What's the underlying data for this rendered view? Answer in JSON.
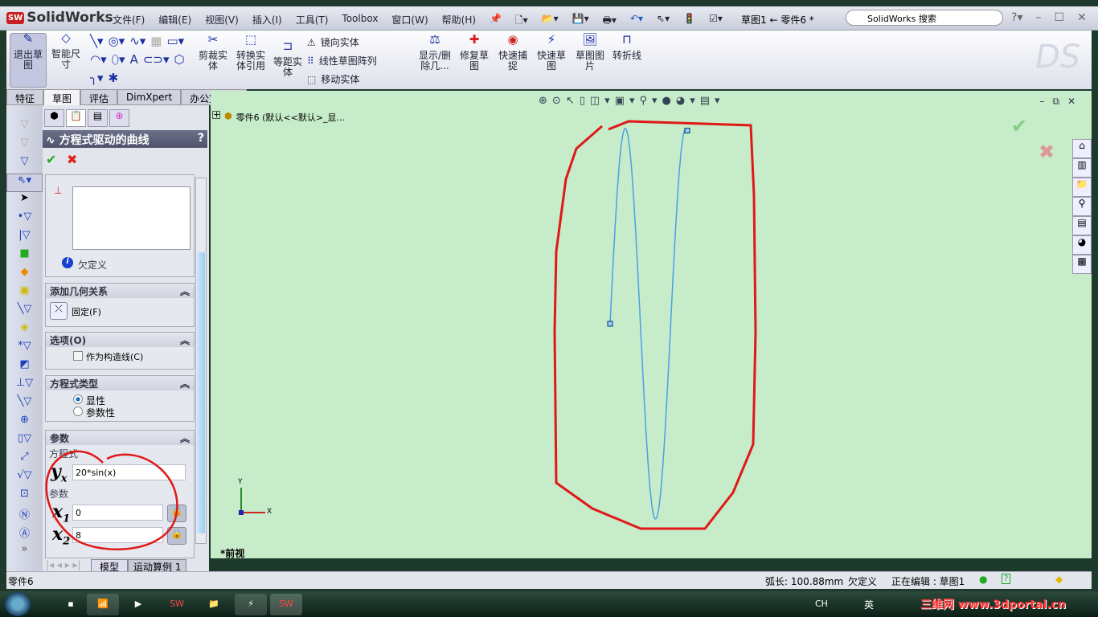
{
  "app": {
    "logo": "SolidWorks",
    "title": "草图1 ← 零件6 *",
    "search_placeholder": "SolidWorks 搜索"
  },
  "menu": [
    "文件(F)",
    "编辑(E)",
    "视图(V)",
    "插入(I)",
    "工具(T)",
    "Toolbox",
    "窗口(W)",
    "帮助(H)"
  ],
  "ribbon": {
    "exit_sketch": "退出草图",
    "smart_dim": "智能尺寸",
    "trim": "剪裁实体",
    "convert": "转换实体引用",
    "offset": "等距实体",
    "mirror": "镜向实体",
    "linear_pattern": "线性草图阵列",
    "move": "移动实体",
    "show_delete": "显示/删除几...",
    "repair": "修复草图",
    "quick_snap": "快速捕捉",
    "rapid_sketch": "快速草图",
    "sketch_picture": "草图图片",
    "jog_line": "转折线"
  },
  "tabs": [
    "特征",
    "草图",
    "评估",
    "DimXpert",
    "办公室产品"
  ],
  "tree": {
    "root": "零件6  (默认<<默认>_显..."
  },
  "pm": {
    "title": "方程式驱动的曲线",
    "status": "欠定义",
    "add_relations": {
      "header": "添加几何关系",
      "fix": "固定(F)"
    },
    "options": {
      "header": "选项(O)",
      "construction": "作为构造线(C)"
    },
    "eq_type": {
      "header": "方程式类型",
      "explicit": "显性",
      "parametric": "参数性",
      "selected": "显性"
    },
    "params": {
      "header": "参数",
      "eq_label": "方程式",
      "yx_var": "y",
      "yx_sub": "x",
      "equation": "20*sin(x)",
      "param_label": "参数",
      "x1_var": "x",
      "x1_sub": "1",
      "x1": "0",
      "x2_var": "x",
      "x2_sub": "2",
      "x2": "8"
    }
  },
  "bottom_tabs": [
    "模型",
    "运动算例 1"
  ],
  "view_label": "*前视",
  "axis": {
    "x": "X",
    "y": "Y"
  },
  "status": {
    "doc": "零件6",
    "arc": "弧长: 100.88mm",
    "def": "欠定义",
    "editing": "正在编辑 : 草图1"
  },
  "taskbar": {
    "lang": "CH",
    "ime": "英",
    "watermark": "三维网 www.3dportal.cn"
  },
  "chart_data": {
    "type": "line",
    "function": "20*sin(x)",
    "x_range": [
      0,
      8
    ],
    "ylim": [
      -20,
      20
    ]
  }
}
